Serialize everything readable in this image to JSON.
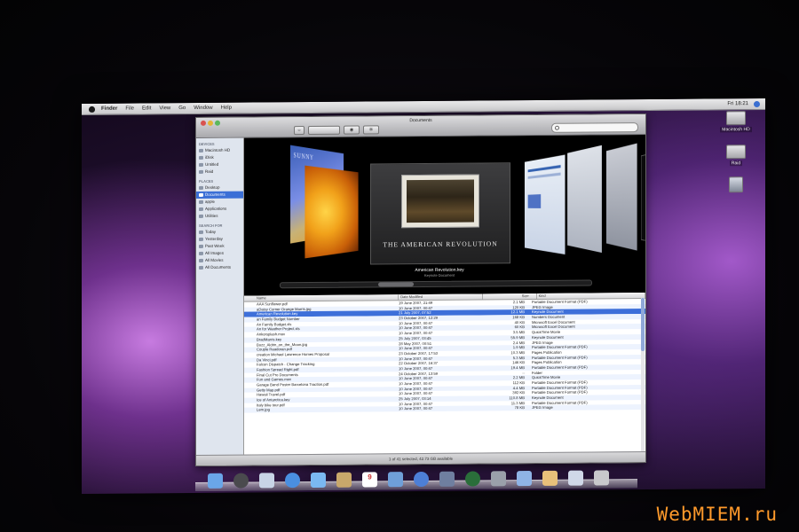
{
  "menubar": {
    "items": [
      "Finder",
      "File",
      "Edit",
      "View",
      "Go",
      "Window",
      "Help"
    ],
    "clock": "Fri 18:21"
  },
  "desktop": {
    "icons": [
      {
        "label": "Macintosh HD",
        "icon": "hard-drive-icon"
      },
      {
        "label": "Raid",
        "icon": "hard-drive-icon"
      },
      {
        "label": "",
        "icon": "disk-image-icon"
      }
    ]
  },
  "window": {
    "title": "Documents",
    "sidebar": {
      "devices_header": "DEVICES",
      "devices": [
        "Macintosh HD",
        "iDisk",
        "Untitled",
        "Raid"
      ],
      "places_header": "PLACES",
      "places": [
        "Desktop",
        "Documents",
        "apple",
        "Applications",
        "Utilities"
      ],
      "search_header": "SEARCH FOR",
      "searches": [
        "Today",
        "Yesterday",
        "Past Week",
        "All Images",
        "All Movies",
        "All Documents"
      ]
    },
    "coverflow": {
      "left_cover_title": "SUNNY",
      "center_title": "THE AMERICAN REVOLUTION",
      "caption": "American Revolution.key",
      "subcaption": "Keynote Document"
    },
    "list": {
      "headers": {
        "name": "Name",
        "date": "Date Modified",
        "size": "Size",
        "kind": "Kind"
      },
      "rows": [
        {
          "name": "AAA Sunflower.pdf",
          "date": "19 June 2007, 21:49",
          "size": "2.1 MB",
          "kind": "Portable Document Format (PDF)"
        },
        {
          "name": "aDaisy Corner Orange Marris.jpg",
          "date": "10 June 2007, 00:47",
          "size": "120 KB",
          "kind": "JPEG Image"
        },
        {
          "name": "American Revolution.key",
          "date": "21 July 2007, 07:52",
          "size": "12.1 MB",
          "kind": "Keynote Document",
          "selected": true
        },
        {
          "name": "an Family Budget Number",
          "date": "23 October 2007, 12:29",
          "size": "168 KB",
          "kind": "Numbers Document"
        },
        {
          "name": "An Family Budget.xls",
          "date": "10 June 2007, 00:47",
          "size": "40 KB",
          "kind": "Microsoft Excel Document"
        },
        {
          "name": "An for Weather Project.xls",
          "date": "10 June 2007, 00:47",
          "size": "60 KB",
          "kind": "Microsoft Excel Document"
        },
        {
          "name": "Ankorsplash.mov",
          "date": "10 June 2007, 00:47",
          "size": "3.5 MB",
          "kind": "QuickTime Movie"
        },
        {
          "name": "BradMarris.key",
          "date": "25 July 2007, 03:45",
          "size": "55.9 MB",
          "kind": "Keynote Document"
        },
        {
          "name": "Buzz_Aldrin_on_the_Moon.jpg",
          "date": "28 May 2007, 00:51",
          "size": "2.4 MB",
          "kind": "JPEG Image"
        },
        {
          "name": "Couple Readoran.pdf",
          "date": "10 June 2007, 00:47",
          "size": "1.9 MB",
          "kind": "Portable Document Format (PDF)"
        },
        {
          "name": "creation Michael Lawrence Homes Proposal",
          "date": "23 October 2007, 17:53",
          "size": "10.3 MB",
          "kind": "Pages Publication"
        },
        {
          "name": "Da Vinci.pdf",
          "date": "10 June 2007, 00:47",
          "size": "5.3 MB",
          "kind": "Portable Document Format (PDF)"
        },
        {
          "name": "Falcon Dispatch - Change Tracking",
          "date": "22 October 2007, 16:37",
          "size": "146 KB",
          "kind": "Pages Publication"
        },
        {
          "name": "Fashion Spread Right.pdf",
          "date": "10 June 2007, 00:47",
          "size": "19.4 MB",
          "kind": "Portable Document Format (PDF)"
        },
        {
          "name": "Final Cut Pro Documents",
          "date": "24 October 2007, 13:59",
          "size": "--",
          "kind": "Folder",
          "folder": true
        },
        {
          "name": "Fun and Games.mov",
          "date": "10 June 2007, 00:47",
          "size": "2.2 MB",
          "kind": "QuickTime Movie"
        },
        {
          "name": "Garage Band Poster Barcelona Traction.pdf",
          "date": "10 June 2007, 00:47",
          "size": "112 KB",
          "kind": "Portable Document Format (PDF)"
        },
        {
          "name": "Getty Map.pdf",
          "date": "10 June 2007, 00:47",
          "size": "4.4 MB",
          "kind": "Portable Document Format (PDF)"
        },
        {
          "name": "Hawaii Travel.pdf",
          "date": "10 June 2007, 00:47",
          "size": "392 KB",
          "kind": "Portable Document Format (PDF)"
        },
        {
          "name": "Ice of Antarctica.key",
          "date": "25 July 2007, 03:14",
          "size": "110.8 MB",
          "kind": "Keynote Document"
        },
        {
          "name": "Italy bike tour.pdf",
          "date": "10 June 2007, 00:47",
          "size": "11.3 MB",
          "kind": "Portable Document Format (PDF)"
        },
        {
          "name": "Lem.jpg",
          "date": "10 June 2007, 00:47",
          "size": "78 KB",
          "kind": "JPEG Image"
        }
      ]
    },
    "status": "1 of 41 selected, 42.73 GB available"
  },
  "dock": {
    "items": [
      "finder-icon",
      "dashboard-icon",
      "mail-icon",
      "safari-icon",
      "ichat-icon",
      "address-book-icon",
      "ical-icon",
      "preview-icon",
      "itunes-icon",
      "iphoto-icon",
      "time-machine-icon",
      "system-preferences-icon",
      "folder-icon",
      "documents-stack-icon",
      "downloads-stack-icon",
      "trash-icon"
    ],
    "ical_day": "9"
  },
  "watermark": "WebMIEM.ru",
  "colors": {
    "selection": "#3d6fd9",
    "wallpaper_accent": "#a259c9",
    "watermark": "#ff9a2b"
  }
}
